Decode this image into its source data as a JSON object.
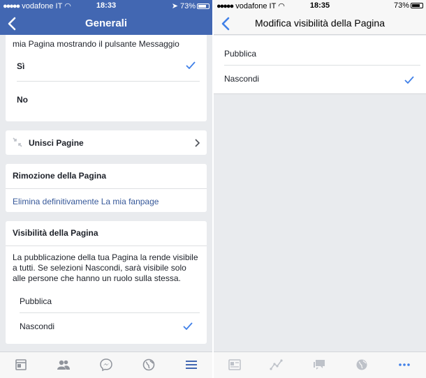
{
  "colors": {
    "fb_blue": "#4267b2",
    "check_blue": "#4080e8",
    "link_blue": "#365899",
    "bg_gray": "#e9ebee"
  },
  "left": {
    "status": {
      "carrier": "vodafone IT",
      "time": "18:33",
      "battery": "73%"
    },
    "nav": {
      "title": "Generali",
      "back_icon": "chevron-left-icon"
    },
    "messages_section": {
      "text": "mia Pagina mostrando il pulsante Messaggio",
      "options": [
        {
          "label": "Sì",
          "checked": true
        },
        {
          "label": "No",
          "checked": false
        }
      ]
    },
    "merge": {
      "label": "Unisci Pagine",
      "icon": "merge-icon",
      "chevron": "chevron-right-icon"
    },
    "removal": {
      "header": "Rimozione della Pagina",
      "link": "Elimina definitivamente La mia fanpage"
    },
    "visibility": {
      "header": "Visibilità della Pagina",
      "description": "La pubblicazione della tua Pagina la rende visibile a tutti. Se selezioni Nascondi, sarà visibile solo alle persone che hanno un ruolo sulla stessa.",
      "options": [
        {
          "label": "Pubblica",
          "checked": false
        },
        {
          "label": "Nascondi",
          "checked": true
        }
      ]
    },
    "tabs": [
      "news-feed-icon",
      "friends-icon",
      "messenger-icon",
      "globe-icon",
      "menu-icon"
    ]
  },
  "right": {
    "status": {
      "carrier": "vodafone IT",
      "time": "18:35",
      "battery": "73%"
    },
    "nav": {
      "title": "Modifica visibilità della Pagina",
      "back_icon": "chevron-left-icon"
    },
    "options": [
      {
        "label": "Pubblica",
        "checked": false
      },
      {
        "label": "Nascondi",
        "checked": true
      }
    ],
    "tabs": [
      "page-icon",
      "insights-icon",
      "inbox-icon",
      "globe-icon",
      "more-icon"
    ]
  }
}
